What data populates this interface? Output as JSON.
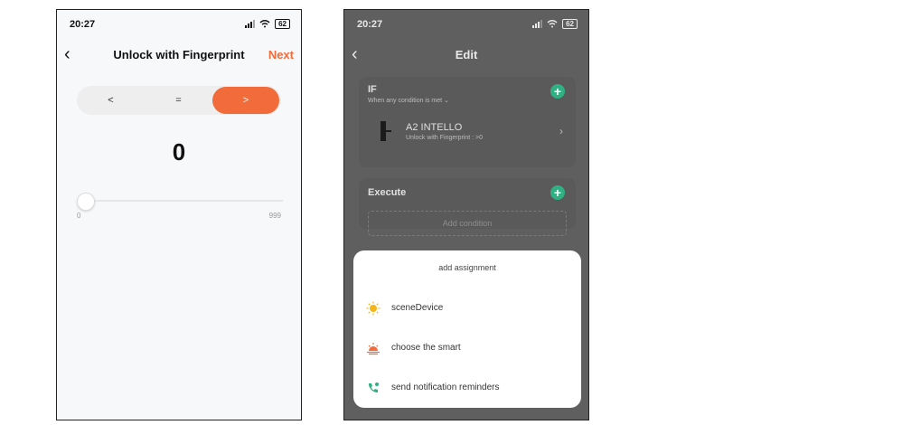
{
  "phone1": {
    "status": {
      "time": "20:27",
      "battery": "62"
    },
    "nav": {
      "title": "Unlock with Fingerprint",
      "next": "Next"
    },
    "operators": [
      "<",
      "=",
      ">"
    ],
    "value": "0",
    "range": {
      "min": "0",
      "max": "999"
    },
    "colors": {
      "accent": "#f26b3a"
    }
  },
  "phone2": {
    "status": {
      "time": "20:27",
      "battery": "62"
    },
    "nav": {
      "title": "Edit"
    },
    "if": {
      "title": "IF",
      "subtitle": "When any condition is met ⌄",
      "device_name": "A2 INTELLO",
      "device_detail": "Unlock with Fingerprint : >0"
    },
    "execute": {
      "title": "Execute",
      "add_condition": "Add condition"
    },
    "sheet": {
      "title": "add assignment",
      "options": [
        {
          "label": "sceneDevice",
          "icon": "bulb-icon"
        },
        {
          "label": "choose the smart",
          "icon": "sunrise-icon"
        },
        {
          "label": "send notification reminders",
          "icon": "phone-icon"
        }
      ]
    },
    "colors": {
      "green": "#2fb184"
    }
  }
}
